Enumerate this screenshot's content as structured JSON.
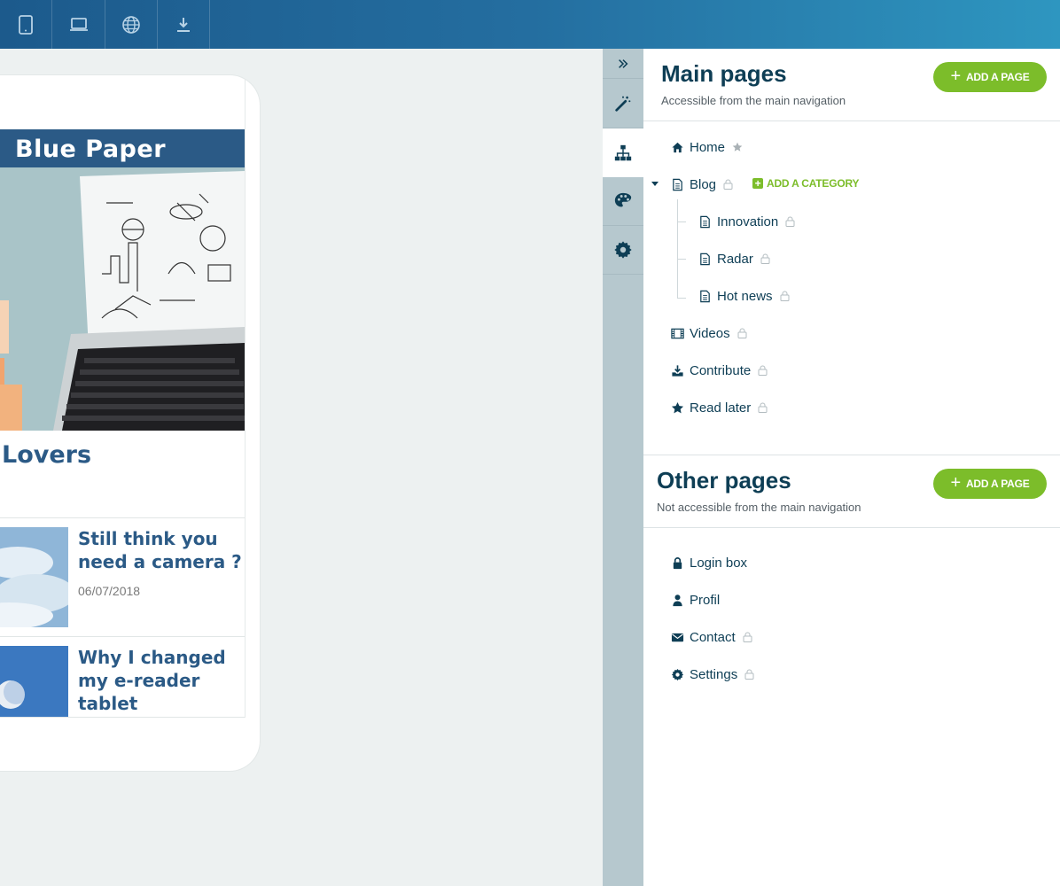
{
  "topbar": {
    "buttons": [
      {
        "name": "tablet-icon"
      },
      {
        "name": "laptop-icon"
      },
      {
        "name": "globe-icon"
      },
      {
        "name": "download-icon"
      }
    ]
  },
  "preview": {
    "site_title": "Blue Paper",
    "featured_title": "Lovers",
    "articles": [
      {
        "title": "Still think you need a camera ?",
        "date": "06/07/2018"
      },
      {
        "title": "Why I changed my e-reader tablet",
        "date": ""
      }
    ]
  },
  "strip": {
    "items": [
      "magic-wand-icon",
      "sitemap-icon",
      "palette-icon",
      "gear-icon"
    ]
  },
  "main_pages": {
    "title": "Main pages",
    "subtitle": "Accessible from the main navigation",
    "add_label": "ADD A PAGE",
    "add_category_label": "ADD A CATEGORY",
    "items": [
      {
        "label": "Home"
      },
      {
        "label": "Blog"
      },
      {
        "label": "Innovation"
      },
      {
        "label": "Radar"
      },
      {
        "label": "Hot news"
      },
      {
        "label": "Videos"
      },
      {
        "label": "Contribute"
      },
      {
        "label": "Read later"
      }
    ]
  },
  "other_pages": {
    "title": "Other pages",
    "subtitle": "Not accessible from the main navigation",
    "add_label": "ADD A PAGE",
    "items": [
      {
        "label": "Login box"
      },
      {
        "label": "Profil"
      },
      {
        "label": "Contact"
      },
      {
        "label": "Settings"
      }
    ]
  },
  "colors": {
    "accent_green": "#7cbd2a",
    "navy": "#0e3e55",
    "brand_blue": "#2b5a86"
  }
}
